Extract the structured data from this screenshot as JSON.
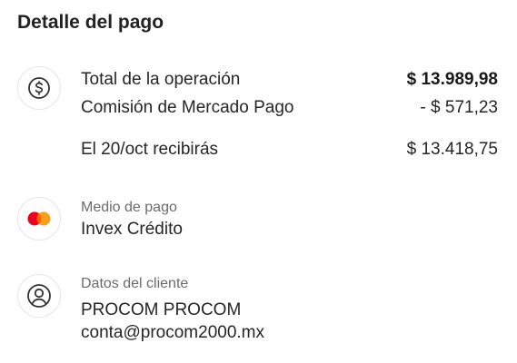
{
  "header": {
    "title": "Detalle del pago"
  },
  "payment": {
    "icon": "dollar-sign-icon",
    "total_label": "Total de la operación",
    "total_amount": "$ 13.989,98",
    "fee_label": "Comisión de Mercado Pago",
    "fee_amount": "- $ 571,23",
    "receive_label": "El 20/oct recibirás",
    "receive_amount": "$ 13.418,75"
  },
  "method": {
    "icon": "mastercard-icon",
    "label": "Medio de pago",
    "value": "Invex Crédito",
    "brand_colors": [
      "#eb001b",
      "#f79e1b"
    ]
  },
  "client": {
    "icon": "user-circle-icon",
    "label": "Datos del cliente",
    "name": "PROCOM PROCOM",
    "email": "conta@procom2000.mx"
  }
}
